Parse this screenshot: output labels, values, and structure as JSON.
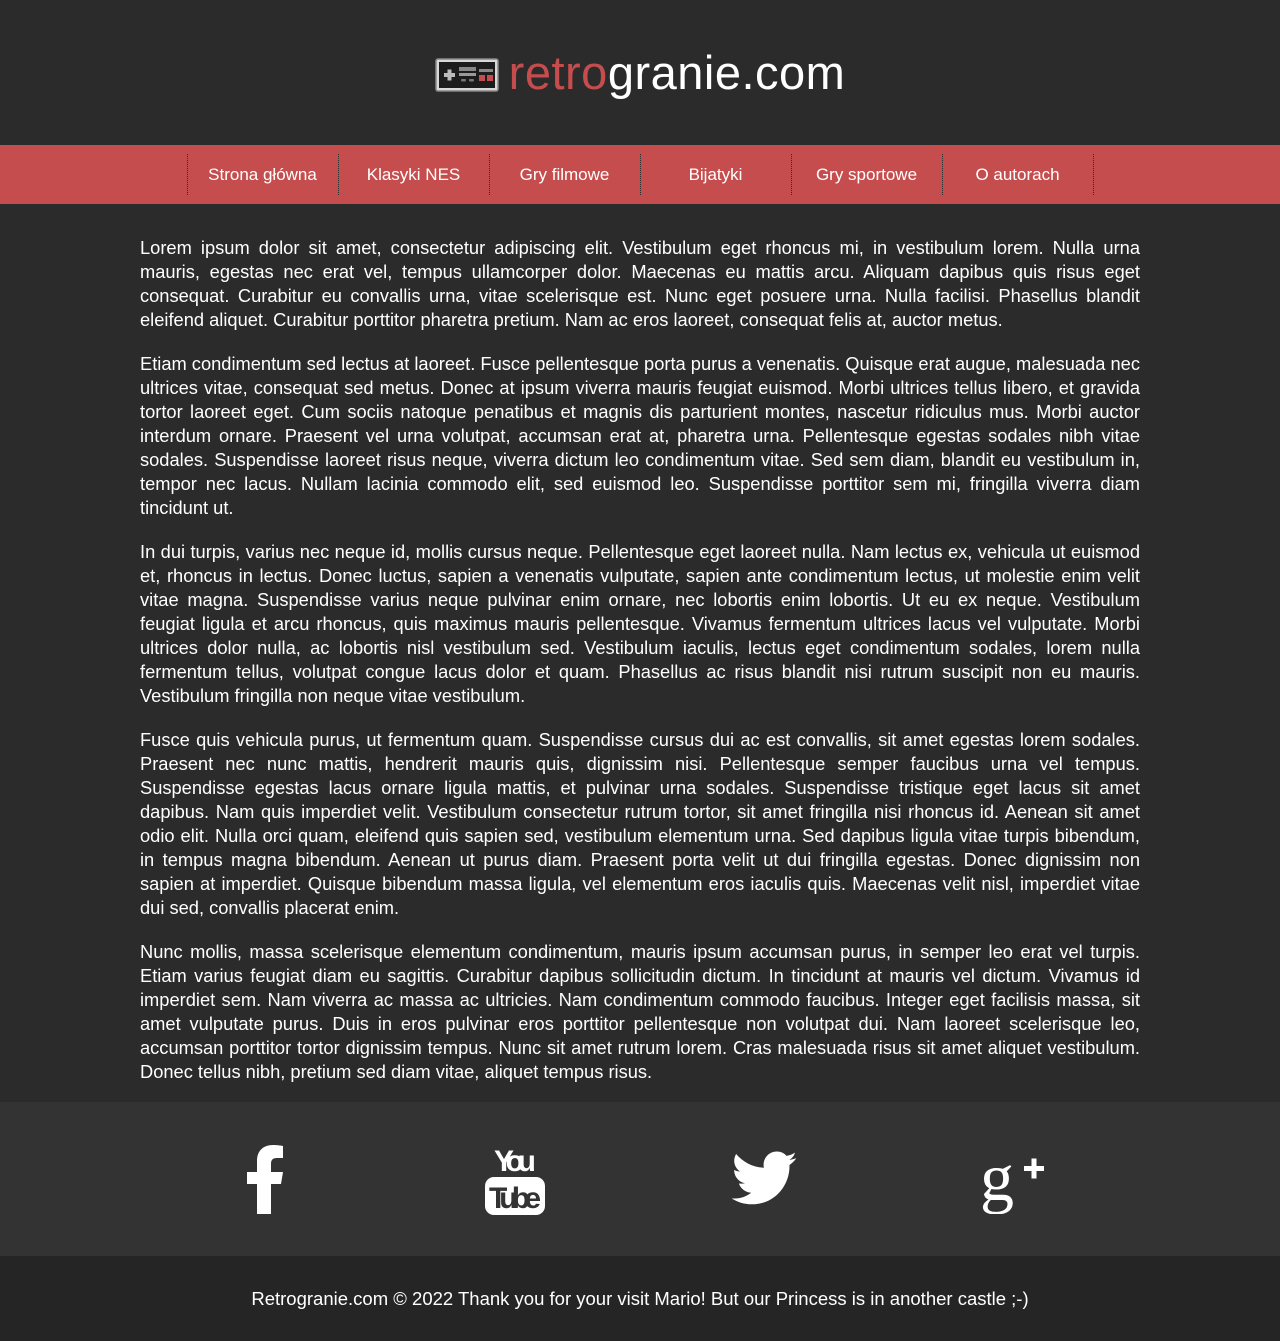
{
  "header": {
    "logo_accent": "retro",
    "logo_rest": "granie.com",
    "icon": "nes-controller-icon",
    "accent_color": "#c64d4d"
  },
  "nav": {
    "items": [
      {
        "label": "Strona główna"
      },
      {
        "label": "Klasyki NES"
      },
      {
        "label": "Gry filmowe"
      },
      {
        "label": "Bijatyki"
      },
      {
        "label": "Gry sportowe"
      },
      {
        "label": "O autorach"
      }
    ]
  },
  "content": {
    "paragraphs": [
      "Lorem ipsum dolor sit amet, consectetur adipiscing elit. Vestibulum eget rhoncus mi, in vestibulum lorem. Nulla urna mauris, egestas nec erat vel, tempus ullamcorper dolor. Maecenas eu mattis arcu. Aliquam dapibus quis risus eget consequat. Curabitur eu convallis urna, vitae scelerisque est. Nunc eget posuere urna. Nulla facilisi. Phasellus blandit eleifend aliquet. Curabitur porttitor pharetra pretium. Nam ac eros laoreet, consequat felis at, auctor metus.",
      "Etiam condimentum sed lectus at laoreet. Fusce pellentesque porta purus a venenatis. Quisque erat augue, malesuada nec ultrices vitae, consequat sed metus. Donec at ipsum viverra mauris feugiat euismod. Morbi ultrices tellus libero, et gravida tortor laoreet eget. Cum sociis natoque penatibus et magnis dis parturient montes, nascetur ridiculus mus. Morbi auctor interdum ornare. Praesent vel urna volutpat, accumsan erat at, pharetra urna. Pellentesque egestas sodales nibh vitae sodales. Suspendisse laoreet risus neque, viverra dictum leo condimentum vitae. Sed sem diam, blandit eu vestibulum in, tempor nec lacus. Nullam lacinia commodo elit, sed euismod leo. Suspendisse porttitor sem mi, fringilla viverra diam tincidunt ut.",
      "In dui turpis, varius nec neque id, mollis cursus neque. Pellentesque eget laoreet nulla. Nam lectus ex, vehicula ut euismod et, rhoncus in lectus. Donec luctus, sapien a venenatis vulputate, sapien ante condimentum lectus, ut molestie enim velit vitae magna. Suspendisse varius neque pulvinar enim ornare, nec lobortis enim lobortis. Ut eu ex neque. Vestibulum feugiat ligula et arcu rhoncus, quis maximus mauris pellentesque. Vivamus fermentum ultrices lacus vel vulputate. Morbi ultrices dolor nulla, ac lobortis nisl vestibulum sed. Vestibulum iaculis, lectus eget condimentum sodales, lorem nulla fermentum tellus, volutpat congue lacus dolor et quam. Phasellus ac risus blandit nisi rutrum suscipit non eu mauris. Vestibulum fringilla non neque vitae vestibulum.",
      "Fusce quis vehicula purus, ut fermentum quam. Suspendisse cursus dui ac est convallis, sit amet egestas lorem sodales. Praesent nec nunc mattis, hendrerit mauris quis, dignissim nisi. Pellentesque semper faucibus urna vel tempus. Suspendisse egestas lacus ornare ligula mattis, et pulvinar urna sodales. Suspendisse tristique eget lacus sit amet dapibus. Nam quis imperdiet velit. Vestibulum consectetur rutrum tortor, sit amet fringilla nisi rhoncus id. Aenean sit amet odio elit. Nulla orci quam, eleifend quis sapien sed, vestibulum elementum urna. Sed dapibus ligula vitae turpis bibendum, in tempus magna bibendum. Aenean ut purus diam. Praesent porta velit ut dui fringilla egestas. Donec dignissim non sapien at imperdiet. Quisque bibendum massa ligula, vel elementum eros iaculis quis. Maecenas velit nisl, imperdiet vitae dui sed, convallis placerat enim.",
      "Nunc mollis, massa scelerisque elementum condimentum, mauris ipsum accumsan purus, in semper leo erat vel turpis. Etiam varius feugiat diam eu sagittis. Curabitur dapibus sollicitudin dictum. In tincidunt at mauris vel dictum. Vivamus id imperdiet sem. Nam viverra ac massa ac ultricies. Nam condimentum commodo faucibus. Integer eget facilisis massa, sit amet vulputate purus. Duis in eros pulvinar eros porttitor pellentesque non volutpat dui. Nam laoreet scelerisque leo, accumsan porttitor tortor dignissim tempus. Nunc sit amet rutrum lorem. Cras malesuada risus sit amet aliquet vestibulum. Donec tellus nibh, pretium sed diam vitae, aliquet tempus risus."
    ]
  },
  "social": {
    "icons": [
      "facebook-icon",
      "youtube-icon",
      "twitter-icon",
      "google-plus-icon"
    ]
  },
  "footer": {
    "text": "Retrogranie.com © 2022 Thank you for your visit Mario! But our Princess is in another castle ;-)"
  }
}
